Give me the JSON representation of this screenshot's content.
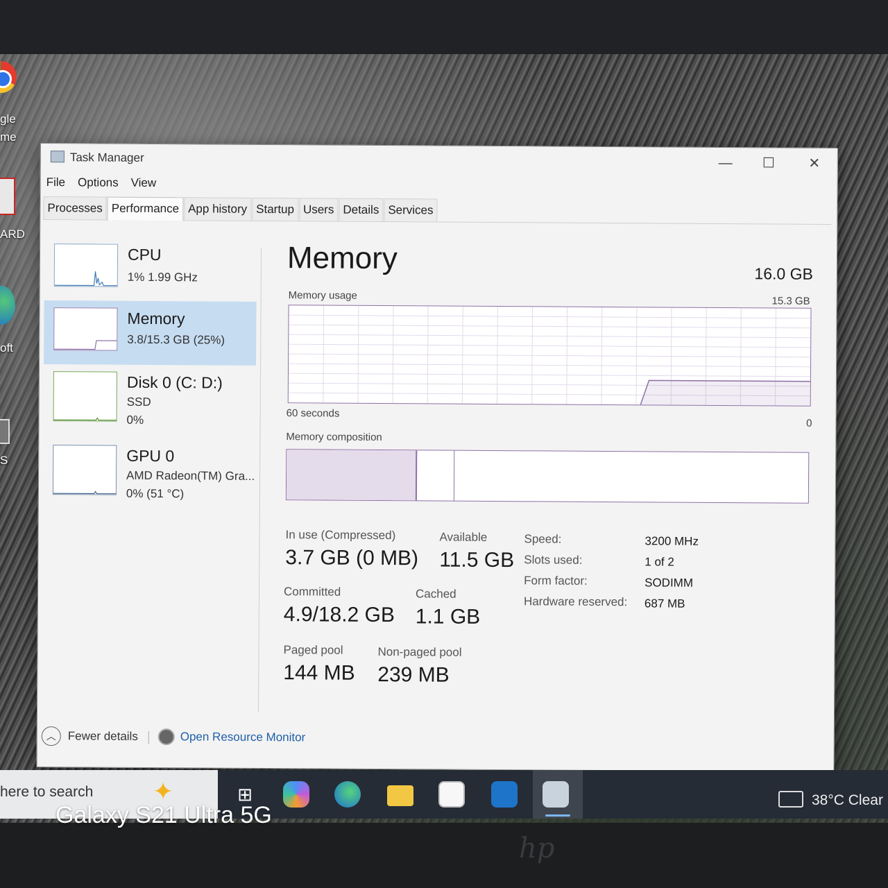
{
  "window": {
    "title": "Task Manager",
    "min_glyph": "—",
    "max_glyph": "☐",
    "close_glyph": "✕"
  },
  "menu": [
    "File",
    "Options",
    "View"
  ],
  "tabs": [
    "Processes",
    "Performance",
    "App history",
    "Startup",
    "Users",
    "Details",
    "Services"
  ],
  "active_tab": "Performance",
  "nav": [
    {
      "title": "CPU",
      "lines": [
        "1%  1.99 GHz"
      ]
    },
    {
      "title": "Memory",
      "lines": [
        "3.8/15.3 GB (25%)"
      ]
    },
    {
      "title": "Disk 0 (C: D:)",
      "lines": [
        "SSD",
        "0%"
      ]
    },
    {
      "title": "GPU 0",
      "lines": [
        "AMD Radeon(TM) Gra...",
        "0%  (51 °C)"
      ]
    }
  ],
  "main": {
    "title": "Memory",
    "total": "16.0 GB",
    "usage_label": "Memory usage",
    "usage_max": "15.3 GB",
    "time_left": "60 seconds",
    "time_right": "0",
    "composition_label": "Memory composition",
    "usage_level": 0.25
  },
  "stats": {
    "in_use_label": "In use (Compressed)",
    "in_use_value": "3.7 GB (0 MB)",
    "available_label": "Available",
    "available_value": "11.5 GB",
    "committed_label": "Committed",
    "committed_value": "4.9/18.2 GB",
    "cached_label": "Cached",
    "cached_value": "1.1 GB",
    "paged_label": "Paged pool",
    "paged_value": "144 MB",
    "nonpaged_label": "Non-paged pool",
    "nonpaged_value": "239 MB"
  },
  "specs": [
    {
      "key": "Speed:",
      "value": "3200 MHz"
    },
    {
      "key": "Slots used:",
      "value": "1 of 2"
    },
    {
      "key": "Form factor:",
      "value": "SODIMM"
    },
    {
      "key": "Hardware reserved:",
      "value": "687 MB"
    }
  ],
  "footer": {
    "fewer": "Fewer details",
    "resource_monitor": "Open Resource Monitor"
  },
  "taskbar": {
    "search": "here to search",
    "weather": "38°C  Clear"
  },
  "desktop_labels": [
    "gle",
    "me",
    "ARD",
    "oft",
    "S"
  ],
  "watermark": "Galaxy S21 Ultra 5G",
  "colors": {
    "memory_accent": "#8d6fa6",
    "selected_nav": "#c6dcf1",
    "link": "#1f5fa8"
  }
}
